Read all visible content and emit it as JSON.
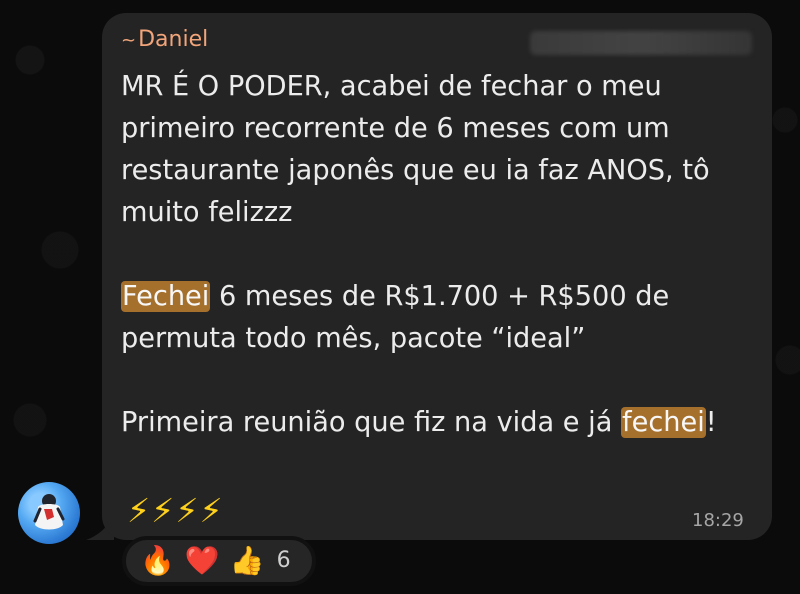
{
  "sender": {
    "prefix": "~",
    "name": "Daniel"
  },
  "message": {
    "line1": "MR É O PODER, acabei de fechar o meu primeiro recorrente de 6 meses com um restaurante japonês que eu ia faz ANOS, tô muito felizzz",
    "line2_highlight": "Fechei",
    "line2_rest": " 6 meses de R$1.700 + R$500 de permuta todo mês, pacote “ideal”",
    "line3_prefix": "Primeira reunião que fiz na vida e já ",
    "line3_highlight": "fechei",
    "line3_suffix": "!",
    "footer_emojis": "⚡⚡⚡⚡",
    "time": "18:29"
  },
  "reactions": {
    "items": [
      "🔥",
      "❤️",
      "👍"
    ],
    "count": "6"
  },
  "colors": {
    "background": "#0b0b0b",
    "bubble": "#242424",
    "sender": "#f2a57a",
    "highlight": "#a56f2c",
    "text": "#ececec",
    "muted": "#a6a6a6"
  }
}
